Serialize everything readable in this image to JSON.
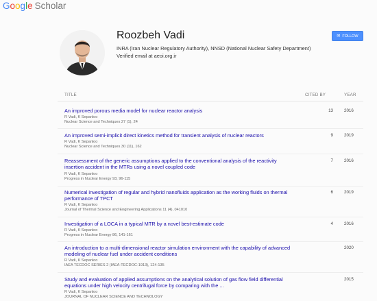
{
  "logo": {
    "google": [
      "G",
      "o",
      "o",
      "g",
      "l",
      "e"
    ],
    "scholar": "Scholar"
  },
  "profile": {
    "name": "Roozbeh Vadi",
    "affiliation": "INRA (Iran Nuclear Regulatory Authority), NNSD (National Nuclear Safety Department)",
    "verified": "Verified email at aeoi.org.ir",
    "follow_label": "FOLLOW"
  },
  "table": {
    "headers": {
      "title": "TITLE",
      "cited": "CITED BY",
      "year": "YEAR"
    },
    "rows": [
      {
        "title": "An improved porous media model for nuclear reactor analysis",
        "authors": "R Vadi, K Sepanloo",
        "venue": "Nuclear Science and Techniques 27 (1), 24",
        "cited": "13",
        "year": "2016"
      },
      {
        "title": "An improved semi-implicit direct kinetics method for transient analysis of nuclear reactors",
        "authors": "R Vadi, K Sepanloo",
        "venue": "Nuclear Science and Techniques 30 (11), 162",
        "cited": "9",
        "year": "2019"
      },
      {
        "title": "Reassessment of the generic assumptions applied to the conventional analysis of the reactivity insertion accident in the MTRs using a novel coupled code",
        "authors": "R Vadi, K Sepanloo",
        "venue": "Progress in Nuclear Energy 93, 96-115",
        "cited": "7",
        "year": "2016"
      },
      {
        "title": "Numerical investigation of regular and hybrid nanofluids application as the working fluids on thermal performance of TPCT",
        "authors": "R Vadi, K Sepanloo",
        "venue": "Journal of Thermal Science and Engineering Applications 11 (4), 041010",
        "cited": "6",
        "year": "2019"
      },
      {
        "title": "Investigation of a LOCA in a typical MTR by a novel best-estimate code",
        "authors": "R Vadi, K Sepanloo",
        "venue": "Progress in Nuclear Energy 86, 141-161",
        "cited": "4",
        "year": "2016"
      },
      {
        "title": "An introduction to a multi-dimensional reactor simulation environment with the capability of advanced modeling of nuclear fuel under accident conditions",
        "authors": "R Vadi, K Sepanloo",
        "venue": "IAEA TECDOC SERIES 2 (IAEA-TECDOC-1913), 124-135",
        "cited": "",
        "year": "2020"
      },
      {
        "title": "Study and evaluation of applied assumptions on the analytical solution of gas flow field differential equations under high velocity centrifugal force by comparing with the ...",
        "authors": "R Vadi, K Sepanloo",
        "venue": "JOURNAL OF NUCLEAR SCIENCE AND TECHNOLOGY",
        "cited": "",
        "year": "2015"
      }
    ]
  },
  "icons": {
    "follow": "envelope-icon",
    "avatar": "profile-photo"
  },
  "colors": {
    "link": "#1a0dab",
    "follow_bg": "#4d90fe"
  }
}
